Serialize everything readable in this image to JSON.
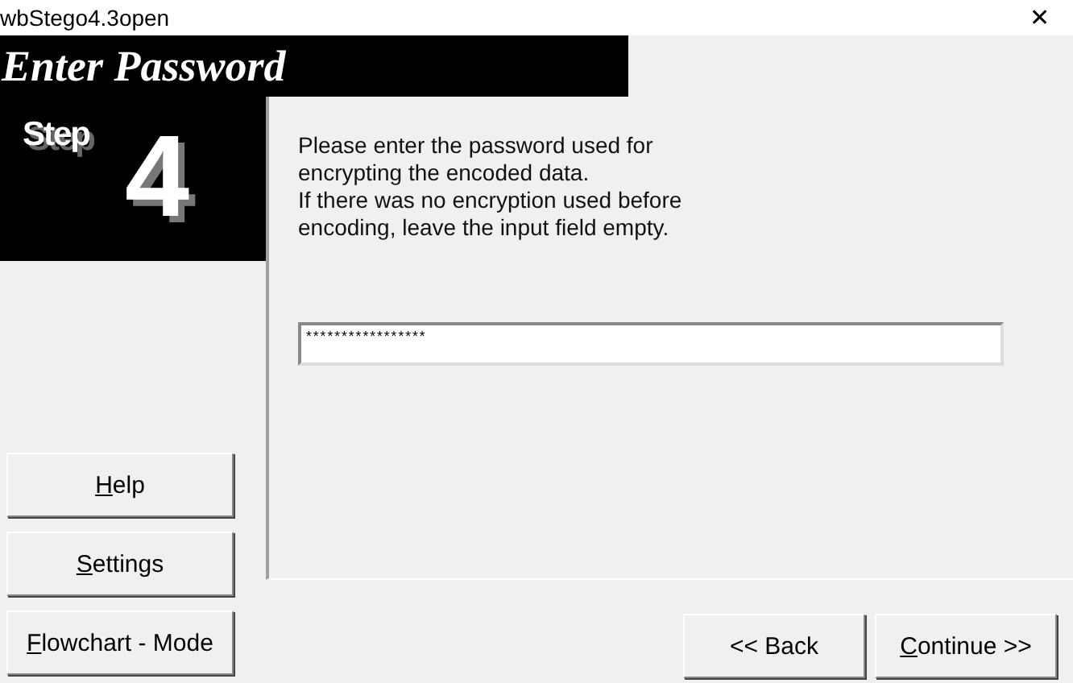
{
  "window": {
    "title": "wbStego4.3open",
    "close": "✕"
  },
  "header": {
    "title": "Enter Password",
    "step_label": "Step",
    "step_number": "4"
  },
  "instructions": [
    "Please enter the password used for",
    "encrypting the encoded data.",
    "If there was no encryption used before",
    "encoding, leave the input field empty."
  ],
  "password_field": {
    "value": "*****************"
  },
  "side_buttons": [
    {
      "label": "Help",
      "underline_first": true
    },
    {
      "label": "Settings",
      "underline_first": true
    },
    {
      "label": "Flowchart - Mode",
      "underline_first": true
    }
  ],
  "nav_buttons": [
    {
      "label": "<< Back",
      "underline_first": false
    },
    {
      "label": "Continue >>",
      "underline_first": true
    }
  ]
}
